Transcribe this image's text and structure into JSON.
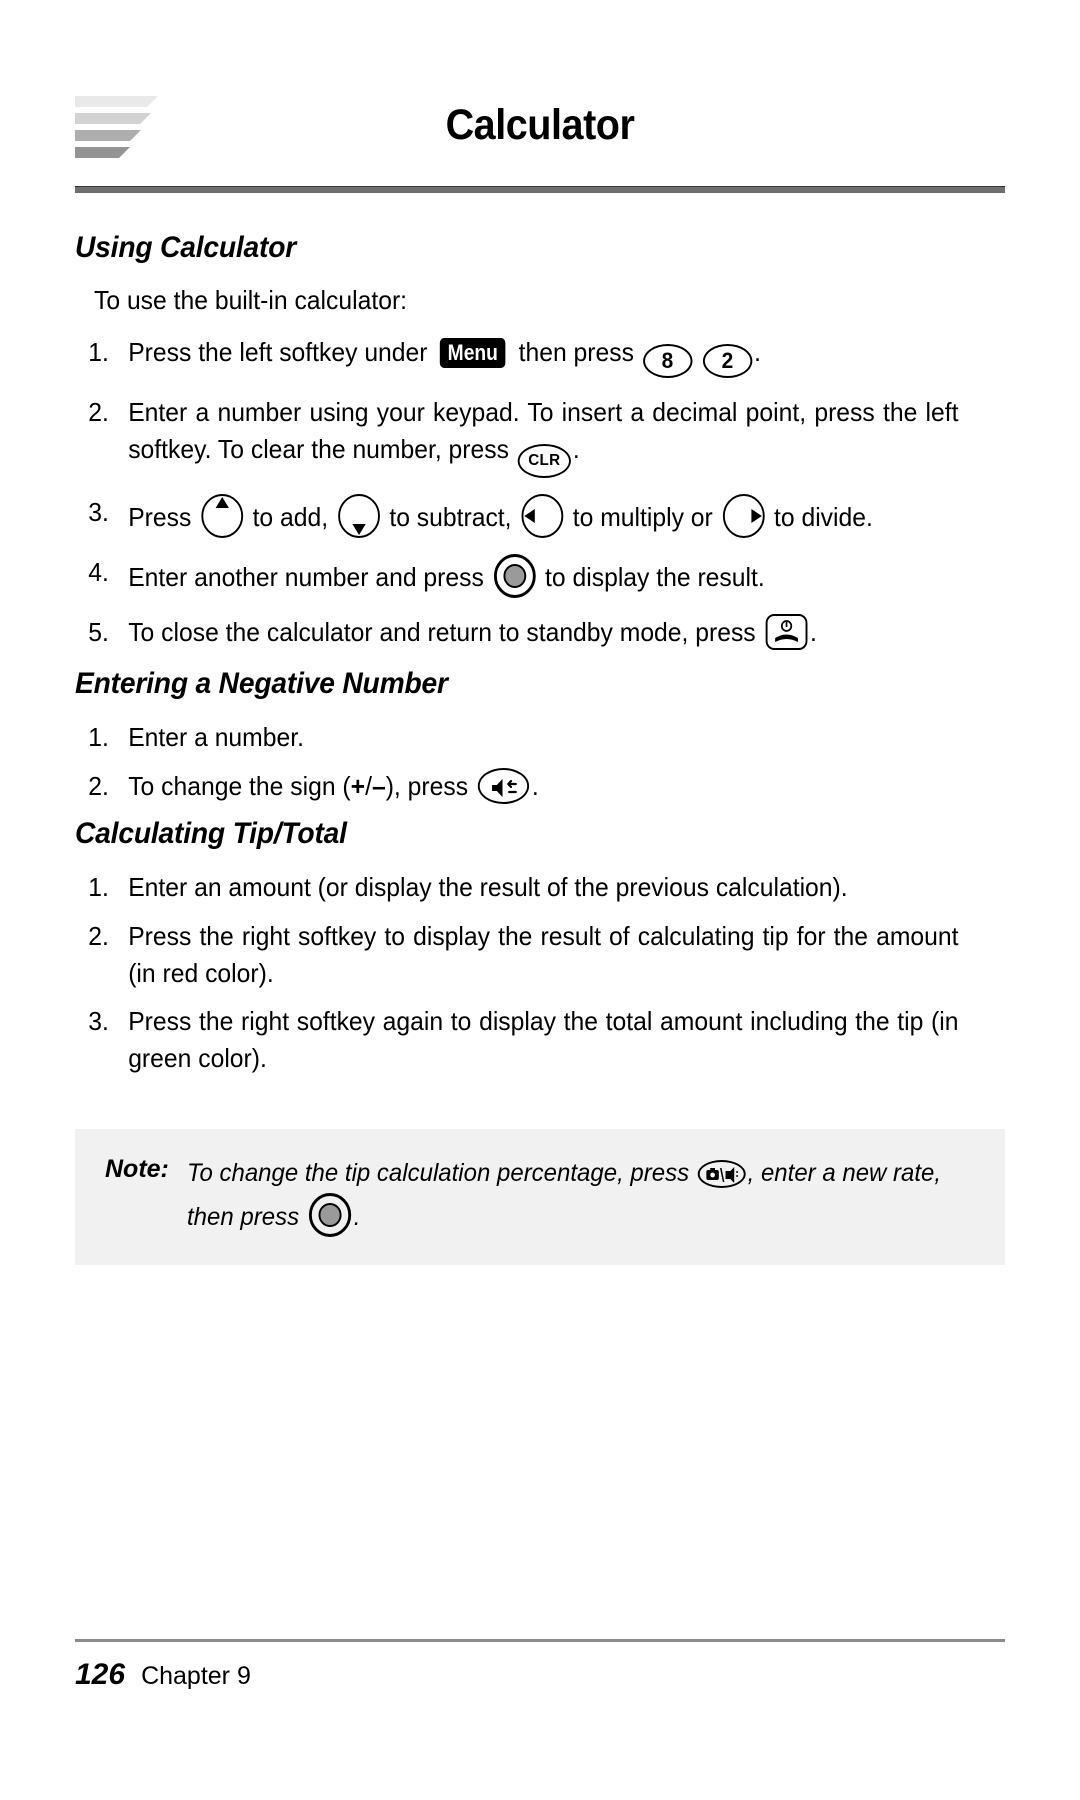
{
  "header": {
    "title": "Calculator",
    "logo_name": "stacked-bars-logo",
    "logo_bar_colors": [
      "#e9e9e9",
      "#d3d3d3",
      "#aeaeae",
      "#949494"
    ],
    "rule_color": "#6e6e6e"
  },
  "sections": [
    {
      "heading": "Using Calculator",
      "intro": "To use the built-in calculator:",
      "steps": [
        {
          "num": "1.",
          "parts": [
            {
              "type": "text",
              "value": "Press the left softkey under "
            },
            {
              "type": "badge",
              "value": "Menu",
              "name": "menu-softkey-badge"
            },
            {
              "type": "text",
              "value": " then press "
            },
            {
              "type": "key-oval",
              "value": "8",
              "name": "key-8-icon"
            },
            {
              "type": "text",
              "value": " "
            },
            {
              "type": "key-oval",
              "value": "2",
              "name": "key-2-icon"
            },
            {
              "type": "text",
              "value": "."
            }
          ]
        },
        {
          "num": "2.",
          "parts": [
            {
              "type": "text",
              "value": "Enter a number using your keypad. To insert a decimal point, press the left softkey. To clear the number, press "
            },
            {
              "type": "key-oval-small",
              "value": "CLR",
              "name": "key-clr-icon"
            },
            {
              "type": "text",
              "value": "."
            }
          ]
        },
        {
          "num": "3.",
          "parts": [
            {
              "type": "text",
              "value": "Press "
            },
            {
              "type": "key-nav-up",
              "value": "",
              "name": "nav-up-key-icon"
            },
            {
              "type": "text",
              "value": " to add, "
            },
            {
              "type": "key-nav-down",
              "value": "",
              "name": "nav-down-key-icon"
            },
            {
              "type": "text",
              "value": " to subtract, "
            },
            {
              "type": "key-nav-left",
              "value": "",
              "name": "nav-left-key-icon"
            },
            {
              "type": "text",
              "value": " to multiply or "
            },
            {
              "type": "key-nav-right",
              "value": "",
              "name": "nav-right-key-icon"
            },
            {
              "type": "text",
              "value": " to divide."
            }
          ]
        },
        {
          "num": "4.",
          "parts": [
            {
              "type": "text",
              "value": "Enter another number and press "
            },
            {
              "type": "key-ok",
              "value": "",
              "name": "ok-key-icon"
            },
            {
              "type": "text",
              "value": " to display the result."
            }
          ]
        },
        {
          "num": "5.",
          "parts": [
            {
              "type": "text",
              "value": "To close the calculator and return to standby mode, press "
            },
            {
              "type": "key-end",
              "value": "",
              "name": "end-key-icon"
            },
            {
              "type": "text",
              "value": "."
            }
          ]
        }
      ]
    },
    {
      "heading": "Entering a Negative Number",
      "intro": "",
      "steps": [
        {
          "num": "1.",
          "parts": [
            {
              "type": "text",
              "value": "Enter a number."
            }
          ]
        },
        {
          "num": "2.",
          "parts": [
            {
              "type": "text",
              "value": "To change the sign ("
            },
            {
              "type": "bold",
              "value": "+"
            },
            {
              "type": "text",
              "value": "/"
            },
            {
              "type": "bold",
              "value": "–"
            },
            {
              "type": "text",
              "value": "), press "
            },
            {
              "type": "key-speaker",
              "value": "",
              "name": "speaker-key-icon"
            },
            {
              "type": "text",
              "value": "."
            }
          ]
        }
      ]
    },
    {
      "heading": "Calculating Tip/Total",
      "intro": "",
      "steps": [
        {
          "num": "1.",
          "parts": [
            {
              "type": "text",
              "value": "Enter an amount (or display the result of the previous calculation)."
            }
          ]
        },
        {
          "num": "2.",
          "parts": [
            {
              "type": "text",
              "value": "Press the right softkey to display the result of calculating tip for the amount (in red color)."
            }
          ]
        },
        {
          "num": "3.",
          "parts": [
            {
              "type": "text",
              "value": "Press the right softkey again to display the total amount including the tip (in green color)."
            }
          ]
        }
      ]
    }
  ],
  "note": {
    "label": "Note:",
    "parts": [
      {
        "type": "text",
        "value": "To change the tip calculation percentage, press "
      },
      {
        "type": "key-camera",
        "value": "",
        "name": "camera-mode-key-icon"
      },
      {
        "type": "text",
        "value": ", enter a new rate, then press "
      },
      {
        "type": "key-ok",
        "value": "",
        "name": "ok-key-icon"
      },
      {
        "type": "text",
        "value": "."
      }
    ],
    "background": "#f1f1f1"
  },
  "footer": {
    "page_number": "126",
    "chapter_label": "Chapter 9",
    "rule_color": "#8c8c8c"
  }
}
